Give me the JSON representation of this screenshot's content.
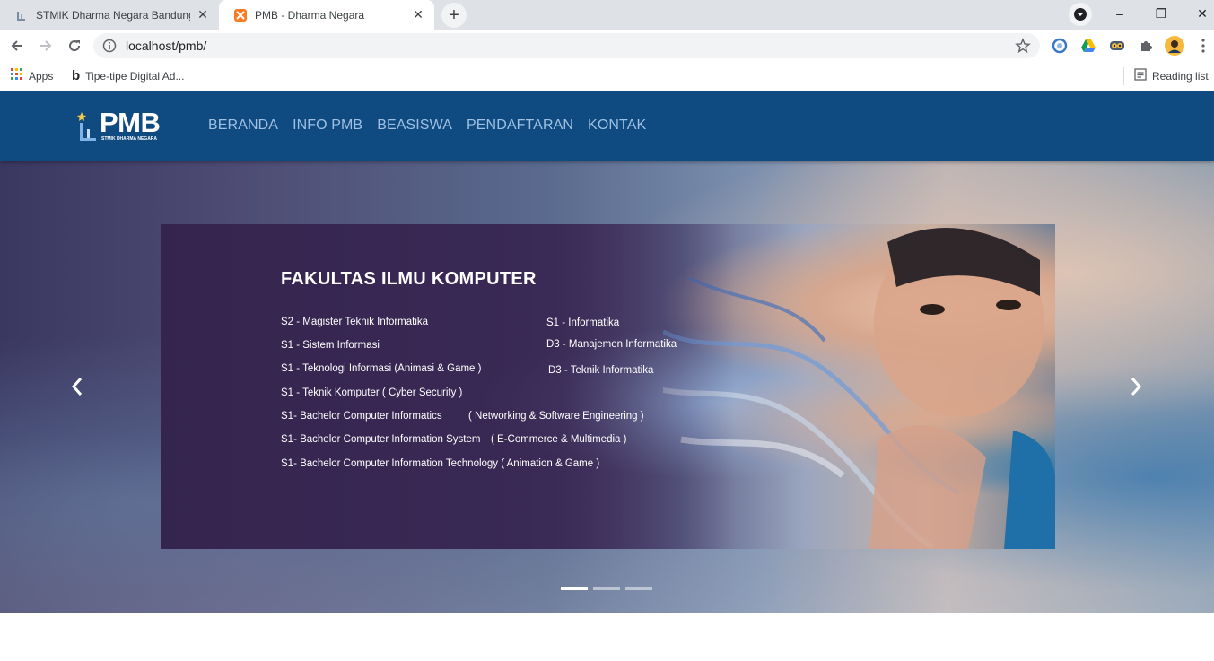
{
  "browser": {
    "tabs": [
      {
        "title": "STMIK Dharma Negara Bandung",
        "close": "✕"
      },
      {
        "title": "PMB - Dharma Negara",
        "close": "✕"
      }
    ],
    "new_tab": "+",
    "address": "localhost/pmb/",
    "bookmarks": [
      {
        "label": "Apps",
        "icon": "apps-grid-icon"
      },
      {
        "label": "Tipe-tipe Digital Ad...",
        "icon": "b-letter-icon"
      }
    ],
    "reading_list": "Reading list",
    "window_controls": {
      "minimize": "–",
      "restore": "❐",
      "close": "✕"
    }
  },
  "site": {
    "logo": {
      "text": "PMB",
      "subtext": "STMIK DHARMA NEGARA"
    },
    "menu": [
      "BERANDA",
      "INFO PMB",
      "BEASISWA",
      "PENDAFTARAN",
      "KONTAK"
    ],
    "colors": {
      "navbar": "#0f4a80",
      "menu_text": "#9fc0e3"
    }
  },
  "carousel": {
    "title": "FAKULTAS ILMU KOMPUTER",
    "programs_left": [
      "S2 - Magister Teknik Informatika",
      "S1 - Sistem Informasi",
      "S1 - Teknologi Informasi (Animasi & Game )",
      "S1 - Teknik Komputer ( Cyber Security )",
      "S1- Bachelor Computer Informatics",
      "S1- Bachelor Computer Information System",
      "S1- Bachelor Computer Information Technology ( Animation & Game )"
    ],
    "programs_right": [
      "S1 - Informatika",
      "D3 - Manajemen Informatika",
      "D3 - Teknik Informatika",
      "( Networking & Software Engineering )",
      "( E-Commerce & Multimedia )"
    ],
    "indicator_count": 3,
    "active_indicator": 1
  }
}
